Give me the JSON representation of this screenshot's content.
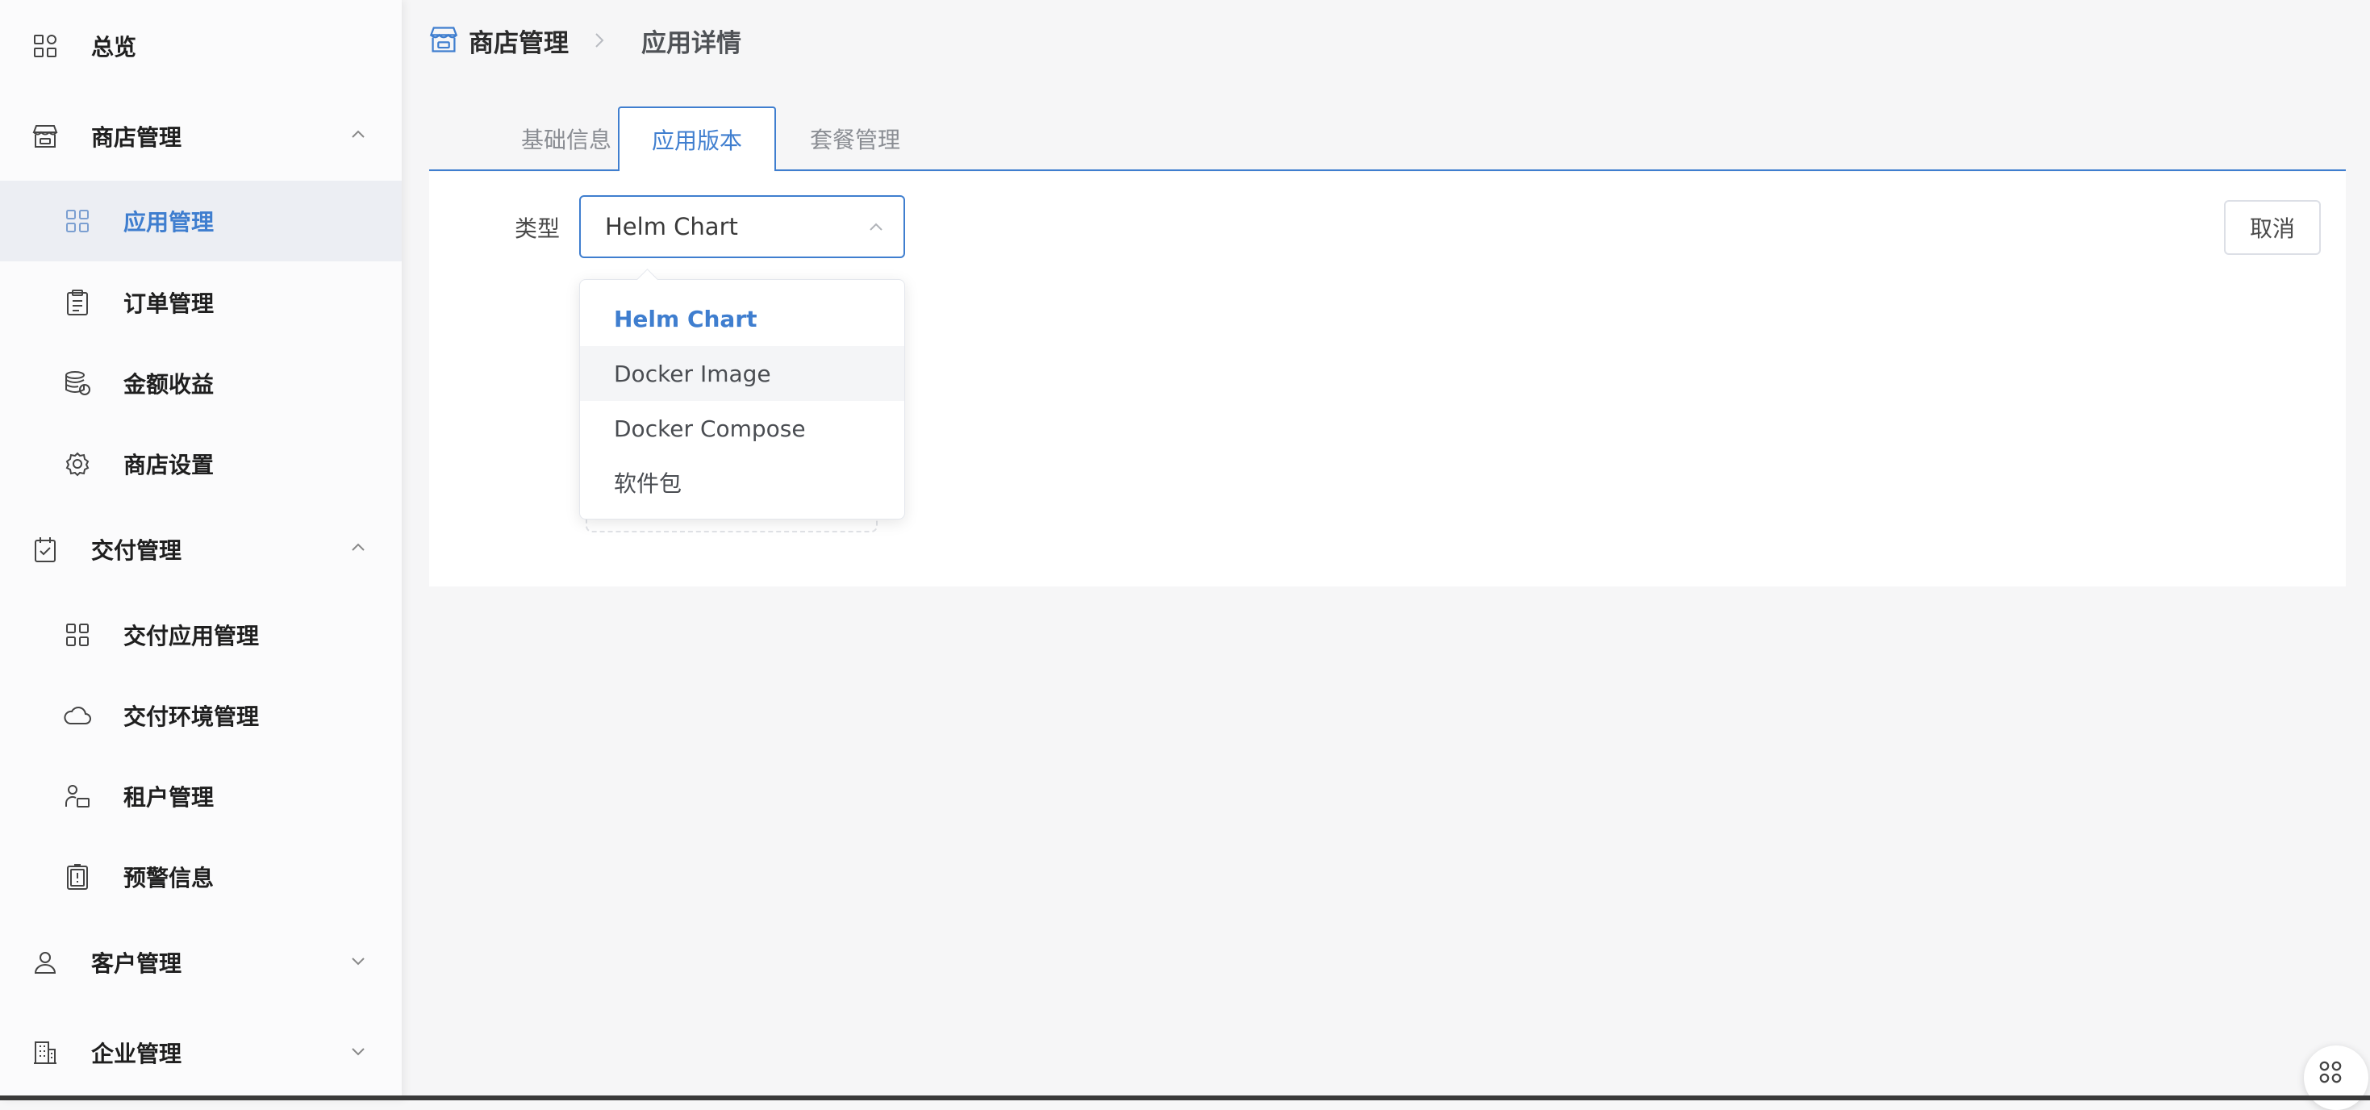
{
  "sidebar": {
    "items": [
      {
        "label": "总览",
        "icon": "dashboard-icon"
      },
      {
        "label": "商店管理",
        "icon": "store-icon",
        "expanded": true
      },
      {
        "label": "应用管理",
        "icon": "app-grid-icon",
        "active": true
      },
      {
        "label": "订单管理",
        "icon": "clipboard-icon"
      },
      {
        "label": "金额收益",
        "icon": "database-icon"
      },
      {
        "label": "商店设置",
        "icon": "gear-icon"
      },
      {
        "label": "交付管理",
        "icon": "calendar-check-icon",
        "expanded": true
      },
      {
        "label": "交付应用管理",
        "icon": "app-grid-icon"
      },
      {
        "label": "交付环境管理",
        "icon": "cloud-icon"
      },
      {
        "label": "租户管理",
        "icon": "tenant-icon"
      },
      {
        "label": "预警信息",
        "icon": "alert-doc-icon"
      },
      {
        "label": "客户管理",
        "icon": "user-icon",
        "expanded": false
      },
      {
        "label": "企业管理",
        "icon": "building-icon",
        "expanded": false
      }
    ]
  },
  "breadcrumb": {
    "parent": "商店管理",
    "current": "应用详情"
  },
  "tabs": [
    {
      "label": "基础信息"
    },
    {
      "label": "应用版本",
      "active": true
    },
    {
      "label": "套餐管理"
    }
  ],
  "form": {
    "type_label": "类型",
    "type_value": "Helm Chart",
    "cancel_label": "取消"
  },
  "dropdown": {
    "options": [
      {
        "label": "Helm Chart",
        "selected": true
      },
      {
        "label": "Docker Image",
        "hovered": true
      },
      {
        "label": "Docker Compose"
      },
      {
        "label": "软件包"
      }
    ]
  },
  "colors": {
    "accent": "#3f7ecf",
    "sidebar_bg": "#fbfbfc",
    "page_bg": "#f6f6f7",
    "active_item_bg": "#eceef3"
  }
}
